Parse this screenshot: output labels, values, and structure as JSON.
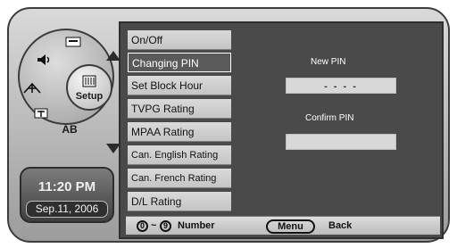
{
  "setup_label": "Setup",
  "menu": {
    "items": [
      {
        "label": "On/Off"
      },
      {
        "label": "Changing PIN"
      },
      {
        "label": "Set Block Hour"
      },
      {
        "label": "TVPG Rating"
      },
      {
        "label": "MPAA Rating"
      },
      {
        "label": "Can. English Rating"
      },
      {
        "label": "Can. French Rating"
      },
      {
        "label": "D/L Rating"
      }
    ]
  },
  "pin": {
    "new_label": "New PIN",
    "new_value": "- - - -",
    "confirm_label": "Confirm PIN",
    "confirm_value": ""
  },
  "footer": {
    "key_start": "0",
    "tilde": "~",
    "key_end": "9",
    "number_label": "Number",
    "menu_key": "Menu",
    "back_label": "Back"
  },
  "clock": {
    "time": "11:20 PM",
    "date": "Sep.11, 2006"
  },
  "dial": {
    "segment_ab": "AB"
  }
}
